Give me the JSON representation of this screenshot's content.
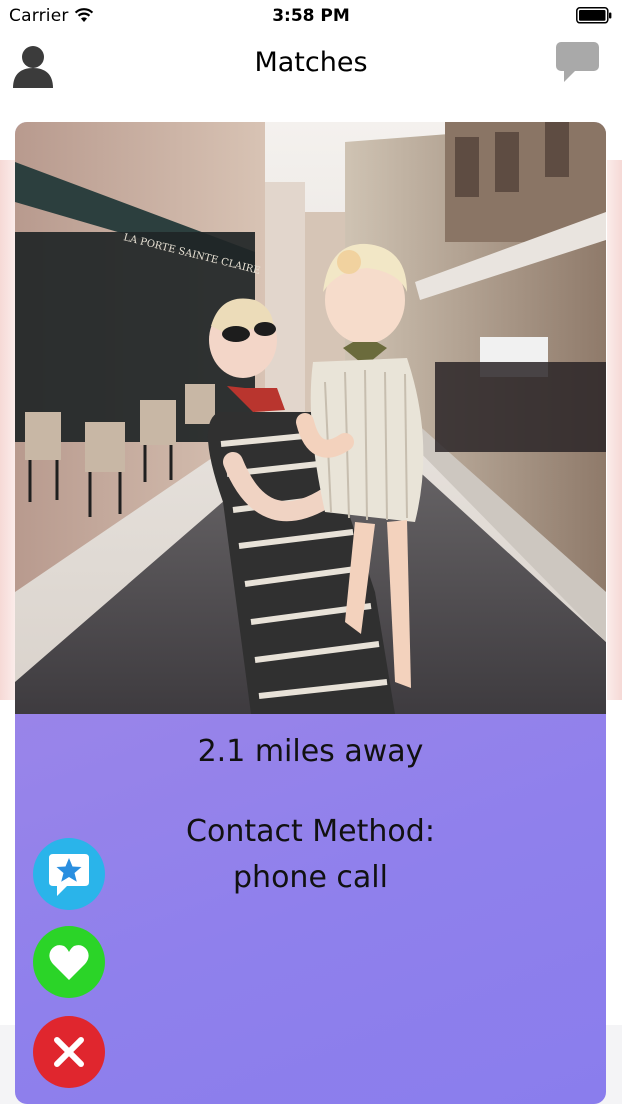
{
  "status_bar": {
    "carrier": "Carrier",
    "time": "3:58 PM"
  },
  "nav": {
    "title": "Matches",
    "left_icon": "profile-icon",
    "right_icon": "chat-bubble-icon"
  },
  "card": {
    "photo_alt": "Woman holding a smiling child on a cobblestone street",
    "storefront_sign": "LA PORTE SAINTE CLAIRE",
    "distance": "2.1 miles away",
    "contact_label": "Contact Method:",
    "contact_value": "phone call"
  },
  "actions": [
    {
      "icon": "star-message-icon",
      "color": "#2ab4ea"
    },
    {
      "icon": "heart-icon",
      "color": "#2bd428"
    },
    {
      "icon": "close-x-icon",
      "color": "#e0262e"
    }
  ],
  "colors": {
    "card_gradient_start": "#a98ce6",
    "card_gradient_end": "#8a7ded"
  }
}
